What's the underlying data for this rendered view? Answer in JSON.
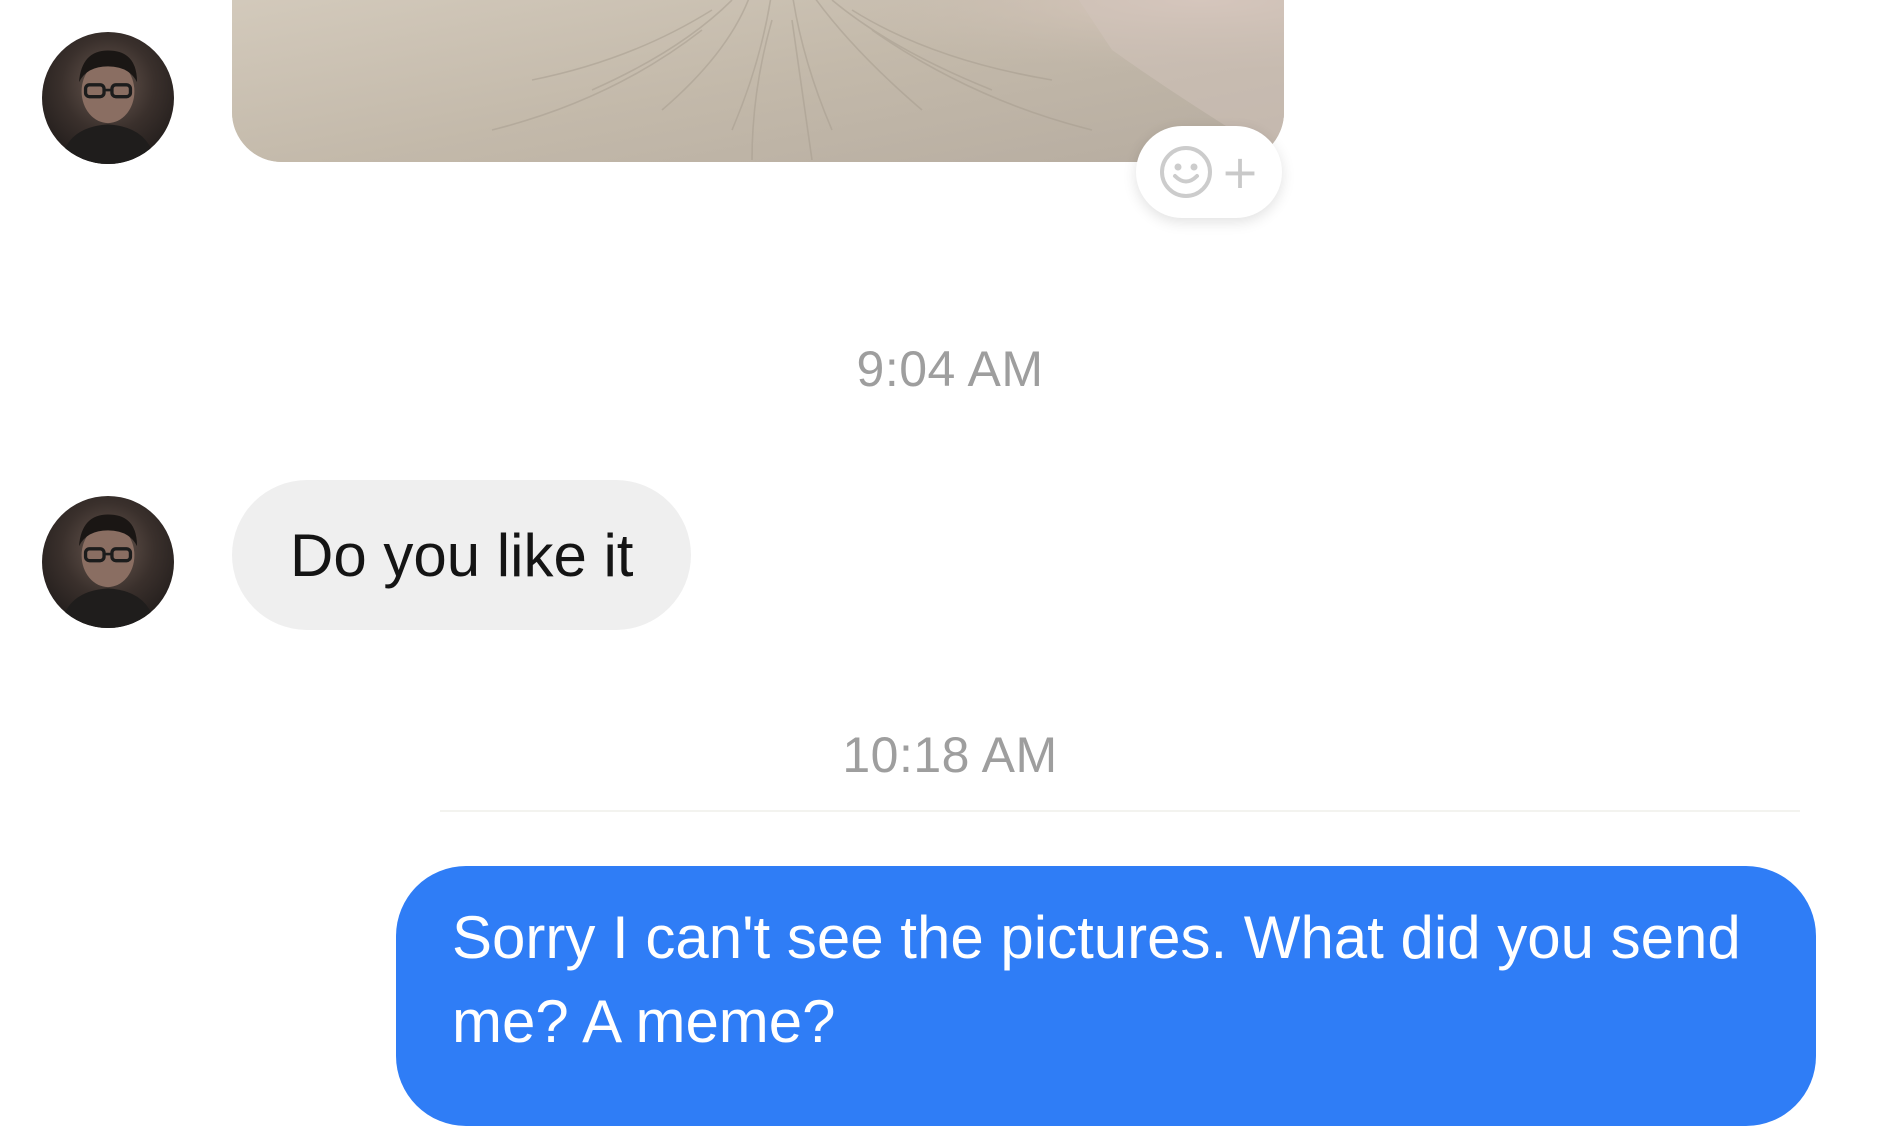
{
  "messages": [
    {
      "type": "photo",
      "direction": "incoming",
      "avatar_icon": "person-avatar-icon"
    },
    {
      "type": "timestamp",
      "text": "9:04 AM"
    },
    {
      "type": "text",
      "direction": "incoming",
      "text": "Do you like it",
      "avatar_icon": "person-avatar-icon"
    },
    {
      "type": "timestamp",
      "text": "10:18 AM"
    },
    {
      "type": "text",
      "direction": "outgoing",
      "text": "Sorry I can't see the pictures. What did you send me? A meme?"
    }
  ],
  "reaction": {
    "icon": "add-reaction-icon",
    "plus": "+"
  },
  "colors": {
    "outgoing_bubble": "#2f7df6",
    "incoming_bubble": "#efefef",
    "timestamp_text": "#9e9e9e"
  }
}
